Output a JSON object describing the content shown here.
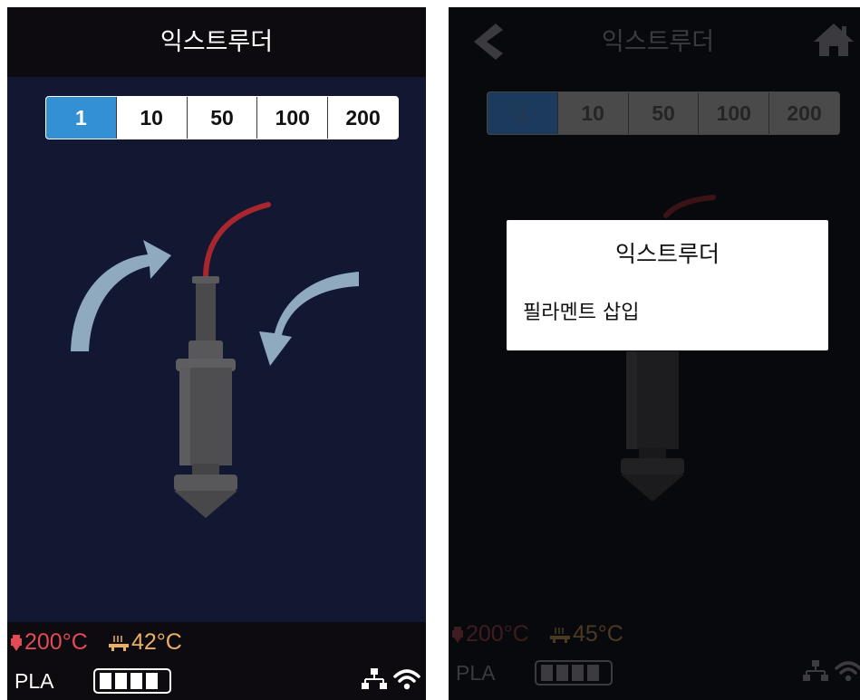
{
  "left_screen": {
    "title": "익스트루더",
    "steps": [
      "1",
      "10",
      "50",
      "100",
      "200"
    ],
    "active_step": "1",
    "nozzle_temp": "200°C",
    "bed_temp": "42°C",
    "material": "PLA",
    "icons": [
      "nozzle-icon",
      "heated-bed-icon",
      "battery-icon",
      "ethernet-icon",
      "wifi-icon"
    ]
  },
  "right_screen": {
    "title": "익스트루더",
    "steps": [
      "1",
      "10",
      "50",
      "100",
      "200"
    ],
    "active_step": "1",
    "nozzle_temp": "200°C",
    "bed_temp": "45°C",
    "material": "PLA",
    "icons": [
      "back-arrow-icon",
      "home-icon",
      "nozzle-icon",
      "heated-bed-icon",
      "battery-icon",
      "ethernet-icon",
      "wifi-icon"
    ],
    "dialog": {
      "title": "익스트루더",
      "message": "필라멘트 삽입"
    }
  },
  "colors": {
    "accent": "#3391d3",
    "background": "#121732",
    "nozzle_temp": "#e14b55",
    "bed_temp": "#eab062",
    "filament": "#a8262d",
    "arrow": "#8faabf"
  }
}
